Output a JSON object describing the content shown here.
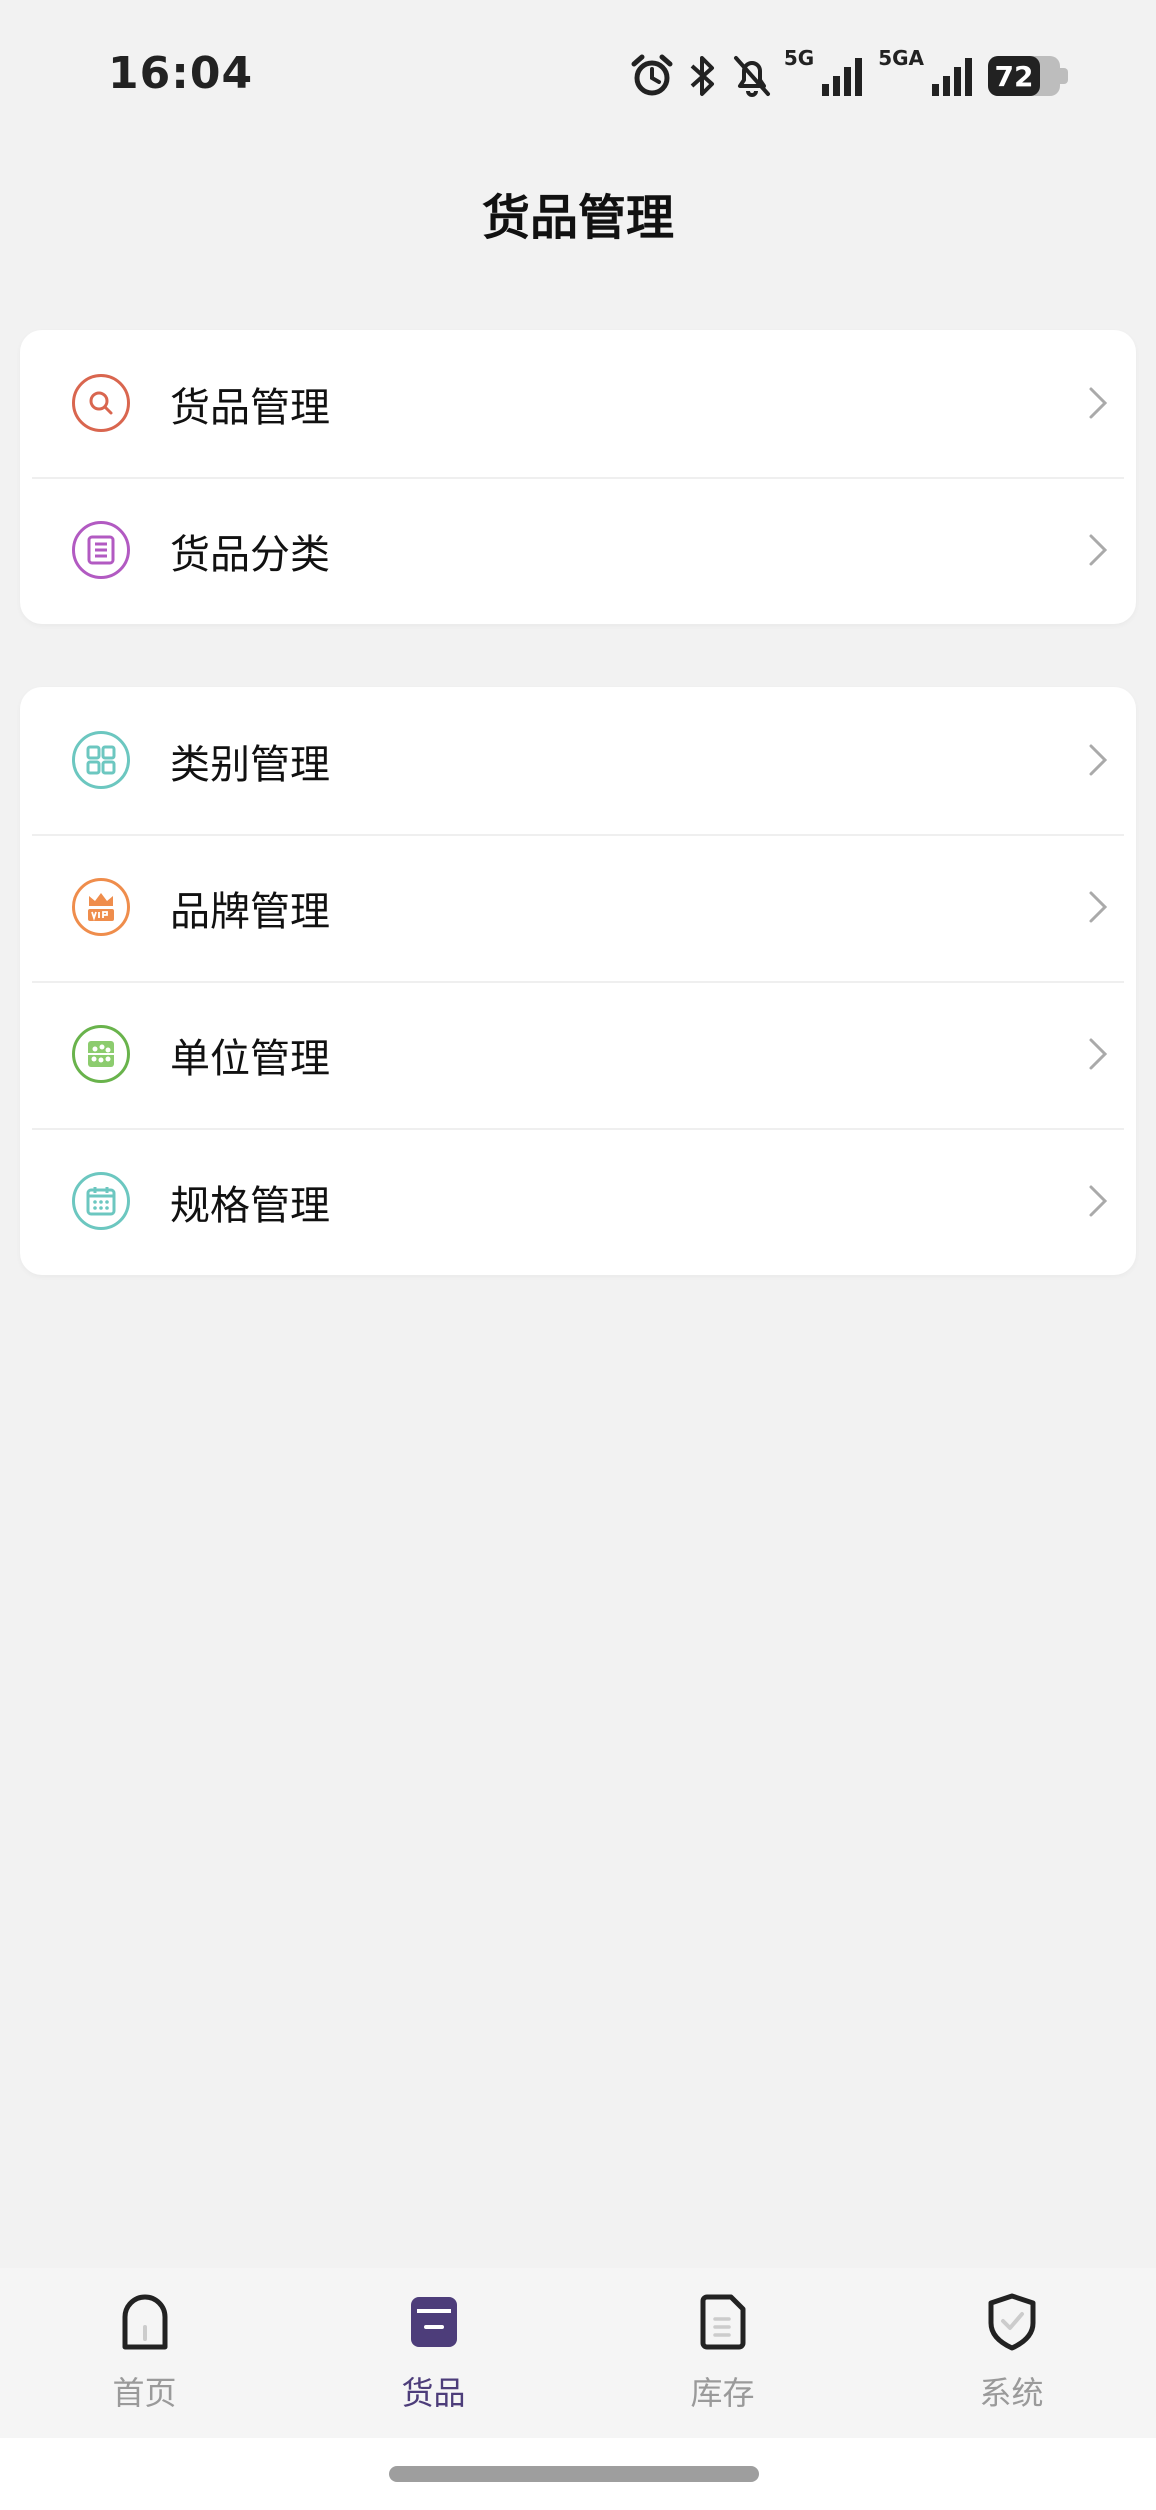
{
  "status_bar": {
    "time": "16:04",
    "net1": "5G",
    "net2": "5GA",
    "battery": "72",
    "battery_level": 0.72,
    "icons": [
      "alarm-icon",
      "bluetooth-icon",
      "mute-bell-icon",
      "signal-icon",
      "signal-icon"
    ]
  },
  "header": {
    "title": "货品管理"
  },
  "group1": {
    "items": [
      {
        "label": "货品管理",
        "icon": "search-icon",
        "color": "#d9664f"
      },
      {
        "label": "货品分类",
        "icon": "list-icon",
        "color": "#b25ac2"
      }
    ]
  },
  "group2": {
    "items": [
      {
        "label": "类别管理",
        "icon": "grid-icon",
        "color": "#6cc7c0"
      },
      {
        "label": "品牌管理",
        "icon": "vip-crown-icon",
        "color": "#ef8d4c"
      },
      {
        "label": "单位管理",
        "icon": "abacus-icon",
        "color": "#69b34c"
      },
      {
        "label": "规格管理",
        "icon": "calendar-icon",
        "color": "#6cc7c0"
      }
    ]
  },
  "tabbar": {
    "active": 1,
    "active_color": "#4d3d7a",
    "inactive_color": "#9a9a9a",
    "tabs": [
      {
        "label": "首页",
        "icon": "home-icon"
      },
      {
        "label": "货品",
        "icon": "goods-icon"
      },
      {
        "label": "库存",
        "icon": "inventory-icon"
      },
      {
        "label": "系统",
        "icon": "shield-icon"
      }
    ]
  }
}
